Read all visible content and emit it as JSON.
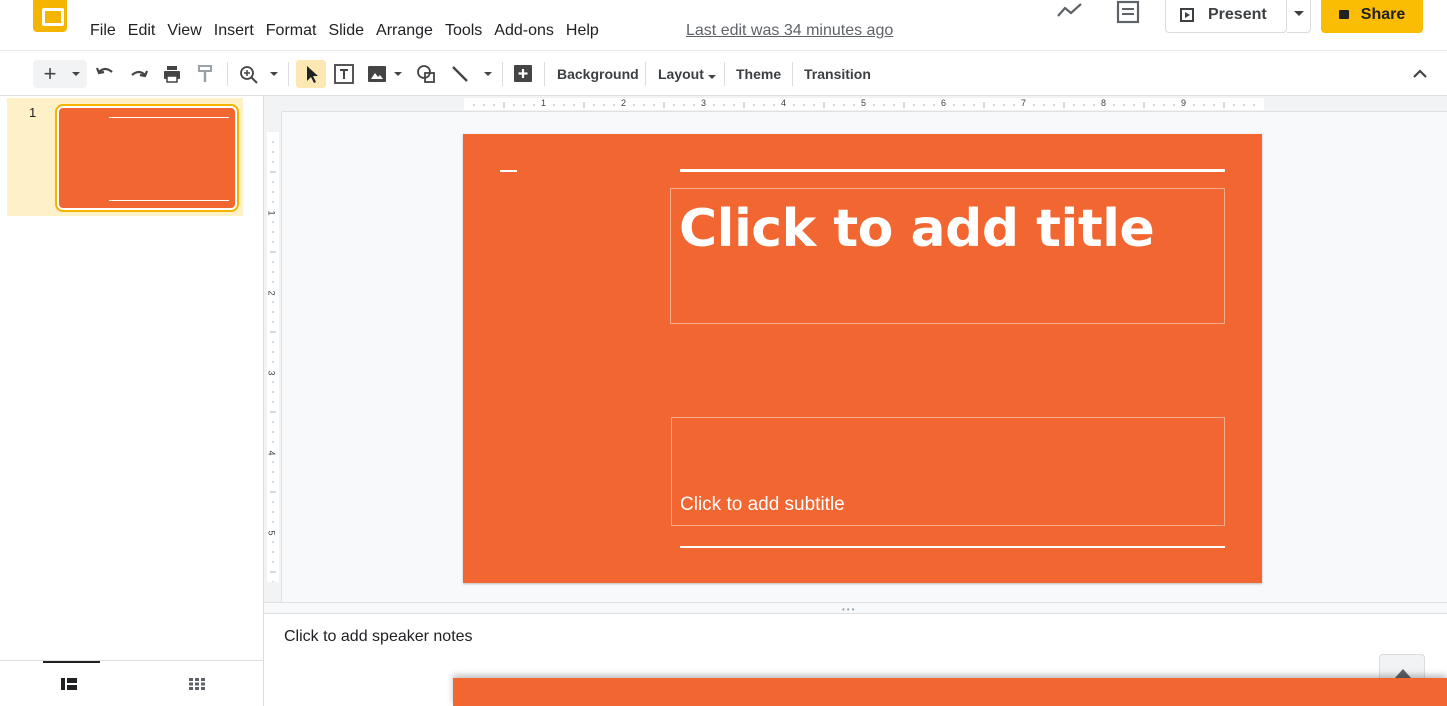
{
  "app": {
    "name": "Google Slides"
  },
  "menu": [
    "File",
    "Edit",
    "View",
    "Insert",
    "Format",
    "Slide",
    "Arrange",
    "Tools",
    "Add-ons",
    "Help"
  ],
  "last_edit": "Last edit was 34 minutes ago",
  "header": {
    "present_label": "Present",
    "share_label": "Share"
  },
  "toolbar": {
    "background_label": "Background",
    "layout_label": "Layout",
    "theme_label": "Theme",
    "transition_label": "Transition"
  },
  "filmstrip": {
    "slides": [
      {
        "number": "1"
      }
    ]
  },
  "rulers": {
    "horizontal": [
      "1",
      "2",
      "3",
      "4",
      "5",
      "6",
      "7",
      "8",
      "9"
    ],
    "vertical": [
      "1",
      "2",
      "3",
      "4",
      "5"
    ]
  },
  "slide": {
    "background_color": "#f16631",
    "title_placeholder": "Click to add title",
    "subtitle_placeholder": "Click to add subtitle"
  },
  "notes": {
    "placeholder": "Click to add speaker notes"
  },
  "colors": {
    "accent": "#fbbc04",
    "logo": "#f4b400",
    "slide": "#f16631",
    "selection": "#fce8b2"
  }
}
